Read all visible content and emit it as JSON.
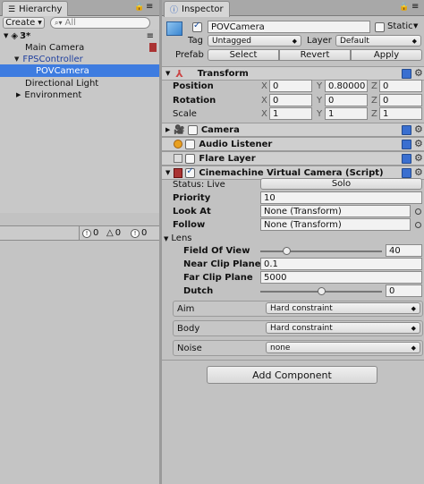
{
  "hierarchy": {
    "tab_label": "Hierarchy",
    "create_label": "Create",
    "search_placeholder": "All",
    "scene_name": "3*",
    "items": [
      "Main Camera",
      "FPSController",
      "POVCamera",
      "Directional Light",
      "Environment"
    ]
  },
  "console": {
    "info_count": "0",
    "warn_count": "0",
    "error_count": "0"
  },
  "inspector": {
    "tab_label": "Inspector",
    "object_name": "POVCamera",
    "static_label": "Static",
    "tag_label": "Tag",
    "tag_value": "Untagged",
    "layer_label": "Layer",
    "layer_value": "Default",
    "prefab_label": "Prefab",
    "prefab_select": "Select",
    "prefab_revert": "Revert",
    "prefab_apply": "Apply",
    "transform": {
      "title": "Transform",
      "position_label": "Position",
      "rotation_label": "Rotation",
      "scale_label": "Scale",
      "x": "X",
      "y": "Y",
      "z": "Z",
      "position": [
        "0",
        "0.80000",
        "0"
      ],
      "rotation": [
        "0",
        "0",
        "0"
      ],
      "scale": [
        "1",
        "1",
        "1"
      ]
    },
    "components": [
      "Camera",
      "Audio Listener",
      "Flare Layer"
    ],
    "vcam": {
      "title": "Cinemachine Virtual Camera (Script)",
      "status_label": "Status: Live",
      "solo_label": "Solo",
      "priority_label": "Priority",
      "priority_value": "10",
      "lookat_label": "Look At",
      "lookat_value": "None (Transform)",
      "follow_label": "Follow",
      "follow_value": "None (Transform)",
      "lens_label": "Lens",
      "fov_label": "Field Of View",
      "fov_value": "40",
      "fov_fraction": 0.22,
      "near_label": "Near Clip Plane",
      "near_value": "0.1",
      "far_label": "Far Clip Plane",
      "far_value": "5000",
      "dutch_label": "Dutch",
      "dutch_value": "0",
      "dutch_fraction": 0.5,
      "aim_label": "Aim",
      "aim_value": "Hard constraint",
      "body_label": "Body",
      "body_value": "Hard constraint",
      "noise_label": "Noise",
      "noise_value": "none"
    },
    "add_component_label": "Add Component"
  }
}
